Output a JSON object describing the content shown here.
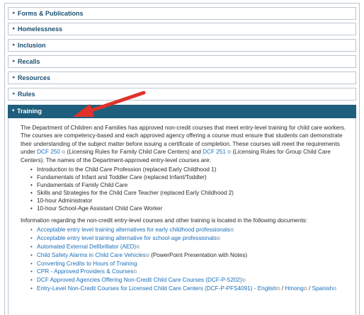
{
  "accordion": {
    "items": [
      {
        "label": "Forms & Publications",
        "chevron": "▸"
      },
      {
        "label": "Homelessness",
        "chevron": "▸"
      },
      {
        "label": "Inclusion",
        "chevron": "▸"
      },
      {
        "label": "Recalls",
        "chevron": "▸"
      },
      {
        "label": "Resources",
        "chevron": "▸"
      },
      {
        "label": "Rules",
        "chevron": "▸"
      }
    ],
    "open": {
      "label": "Training",
      "chevron": "▾"
    }
  },
  "training": {
    "intro_a": "The Department of Children and Families has approved non-credit courses that meet entry-level training for child care workers. The courses are competency-based and each approved agency offering a course must ensure that students can demonstrate their understanding of the subject matter before issuing a certificate of completion. These courses will meet the requirements under ",
    "dcf250": "DCF 250",
    "intro_b": " (Licensing Rules for Family Child Care Centers) and ",
    "dcf251": "DCF 251",
    "intro_c": " (Licensing Rules for Group Child Care Centers). The names of the Department-approved entry-level courses are:",
    "courses": [
      "Introduction to the Child Care Profession (replaced Early Childhood 1)",
      "Fundamentals of Infant and Toddler Care (replaced Infant/Toddler)",
      "Fundamentals of Family Child Care",
      "Skills and Strategies for the Child Care Teacher (replaced Early Childhood 2)",
      "10-hour Administrator",
      "10-hour School-Age Assistant Child Care Worker"
    ],
    "info": "Information regarding the non-credit entry-level courses and other training is located in the following documents:",
    "links": [
      {
        "text": "Acceptable entry level training alternatives for early childhood professionals",
        "ext": true,
        "suffix": ""
      },
      {
        "text": "Acceptable entry level training alternative for school-age professionals",
        "ext": true,
        "suffix": ""
      },
      {
        "text": "Automated External Defibrillator (AED)",
        "ext": true,
        "suffix": ""
      },
      {
        "text": "Child Safety Alarms in Child Care Vehicles",
        "ext": true,
        "suffix": " (PowerPoint Presentation with Notes)"
      },
      {
        "text": "Converting Credits to Hours of Training",
        "ext": false,
        "suffix": ""
      },
      {
        "text": "CPR - Approved Providers & Courses",
        "ext": true,
        "suffix": ""
      },
      {
        "text": "DCF Approved Agencies Offering Non-Credit Child Care Courses (DCF-P-5202)",
        "ext": true,
        "suffix": ""
      },
      {
        "text": "Entry-Level Non-Credit Courses for Licensed Child Care Centers (DCF-P-PFS4091) - English",
        "ext": true,
        "suffix": " / ",
        "more": [
          {
            "text": "Hmong",
            "ext": true
          },
          {
            "text": "Spanish",
            "ext": true
          }
        ]
      }
    ]
  },
  "colors": {
    "header_bg": "#1f5e7c",
    "link": "#1a6fb8",
    "arrow": "#e0322b"
  },
  "icons": {
    "ext": "⧉"
  }
}
